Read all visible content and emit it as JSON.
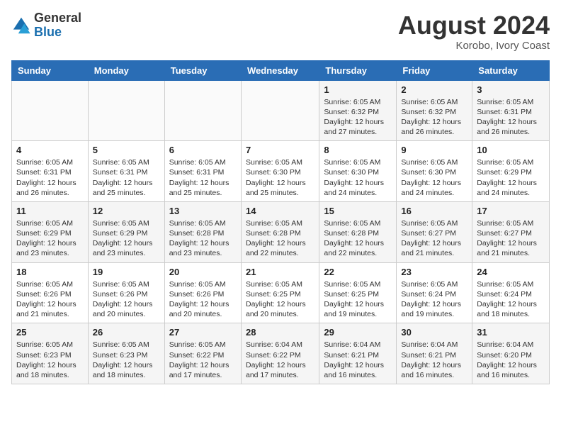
{
  "header": {
    "logo_general": "General",
    "logo_blue": "Blue",
    "month_year": "August 2024",
    "location": "Korobo, Ivory Coast"
  },
  "weekdays": [
    "Sunday",
    "Monday",
    "Tuesday",
    "Wednesday",
    "Thursday",
    "Friday",
    "Saturday"
  ],
  "weeks": [
    [
      {
        "day": "",
        "detail": ""
      },
      {
        "day": "",
        "detail": ""
      },
      {
        "day": "",
        "detail": ""
      },
      {
        "day": "",
        "detail": ""
      },
      {
        "day": "1",
        "detail": "Sunrise: 6:05 AM\nSunset: 6:32 PM\nDaylight: 12 hours and 27 minutes."
      },
      {
        "day": "2",
        "detail": "Sunrise: 6:05 AM\nSunset: 6:32 PM\nDaylight: 12 hours and 26 minutes."
      },
      {
        "day": "3",
        "detail": "Sunrise: 6:05 AM\nSunset: 6:31 PM\nDaylight: 12 hours and 26 minutes."
      }
    ],
    [
      {
        "day": "4",
        "detail": "Sunrise: 6:05 AM\nSunset: 6:31 PM\nDaylight: 12 hours and 26 minutes."
      },
      {
        "day": "5",
        "detail": "Sunrise: 6:05 AM\nSunset: 6:31 PM\nDaylight: 12 hours and 25 minutes."
      },
      {
        "day": "6",
        "detail": "Sunrise: 6:05 AM\nSunset: 6:31 PM\nDaylight: 12 hours and 25 minutes."
      },
      {
        "day": "7",
        "detail": "Sunrise: 6:05 AM\nSunset: 6:30 PM\nDaylight: 12 hours and 25 minutes."
      },
      {
        "day": "8",
        "detail": "Sunrise: 6:05 AM\nSunset: 6:30 PM\nDaylight: 12 hours and 24 minutes."
      },
      {
        "day": "9",
        "detail": "Sunrise: 6:05 AM\nSunset: 6:30 PM\nDaylight: 12 hours and 24 minutes."
      },
      {
        "day": "10",
        "detail": "Sunrise: 6:05 AM\nSunset: 6:29 PM\nDaylight: 12 hours and 24 minutes."
      }
    ],
    [
      {
        "day": "11",
        "detail": "Sunrise: 6:05 AM\nSunset: 6:29 PM\nDaylight: 12 hours and 23 minutes."
      },
      {
        "day": "12",
        "detail": "Sunrise: 6:05 AM\nSunset: 6:29 PM\nDaylight: 12 hours and 23 minutes."
      },
      {
        "day": "13",
        "detail": "Sunrise: 6:05 AM\nSunset: 6:28 PM\nDaylight: 12 hours and 23 minutes."
      },
      {
        "day": "14",
        "detail": "Sunrise: 6:05 AM\nSunset: 6:28 PM\nDaylight: 12 hours and 22 minutes."
      },
      {
        "day": "15",
        "detail": "Sunrise: 6:05 AM\nSunset: 6:28 PM\nDaylight: 12 hours and 22 minutes."
      },
      {
        "day": "16",
        "detail": "Sunrise: 6:05 AM\nSunset: 6:27 PM\nDaylight: 12 hours and 21 minutes."
      },
      {
        "day": "17",
        "detail": "Sunrise: 6:05 AM\nSunset: 6:27 PM\nDaylight: 12 hours and 21 minutes."
      }
    ],
    [
      {
        "day": "18",
        "detail": "Sunrise: 6:05 AM\nSunset: 6:26 PM\nDaylight: 12 hours and 21 minutes."
      },
      {
        "day": "19",
        "detail": "Sunrise: 6:05 AM\nSunset: 6:26 PM\nDaylight: 12 hours and 20 minutes."
      },
      {
        "day": "20",
        "detail": "Sunrise: 6:05 AM\nSunset: 6:26 PM\nDaylight: 12 hours and 20 minutes."
      },
      {
        "day": "21",
        "detail": "Sunrise: 6:05 AM\nSunset: 6:25 PM\nDaylight: 12 hours and 20 minutes."
      },
      {
        "day": "22",
        "detail": "Sunrise: 6:05 AM\nSunset: 6:25 PM\nDaylight: 12 hours and 19 minutes."
      },
      {
        "day": "23",
        "detail": "Sunrise: 6:05 AM\nSunset: 6:24 PM\nDaylight: 12 hours and 19 minutes."
      },
      {
        "day": "24",
        "detail": "Sunrise: 6:05 AM\nSunset: 6:24 PM\nDaylight: 12 hours and 18 minutes."
      }
    ],
    [
      {
        "day": "25",
        "detail": "Sunrise: 6:05 AM\nSunset: 6:23 PM\nDaylight: 12 hours and 18 minutes."
      },
      {
        "day": "26",
        "detail": "Sunrise: 6:05 AM\nSunset: 6:23 PM\nDaylight: 12 hours and 18 minutes."
      },
      {
        "day": "27",
        "detail": "Sunrise: 6:05 AM\nSunset: 6:22 PM\nDaylight: 12 hours and 17 minutes."
      },
      {
        "day": "28",
        "detail": "Sunrise: 6:04 AM\nSunset: 6:22 PM\nDaylight: 12 hours and 17 minutes."
      },
      {
        "day": "29",
        "detail": "Sunrise: 6:04 AM\nSunset: 6:21 PM\nDaylight: 12 hours and 16 minutes."
      },
      {
        "day": "30",
        "detail": "Sunrise: 6:04 AM\nSunset: 6:21 PM\nDaylight: 12 hours and 16 minutes."
      },
      {
        "day": "31",
        "detail": "Sunrise: 6:04 AM\nSunset: 6:20 PM\nDaylight: 12 hours and 16 minutes."
      }
    ]
  ]
}
